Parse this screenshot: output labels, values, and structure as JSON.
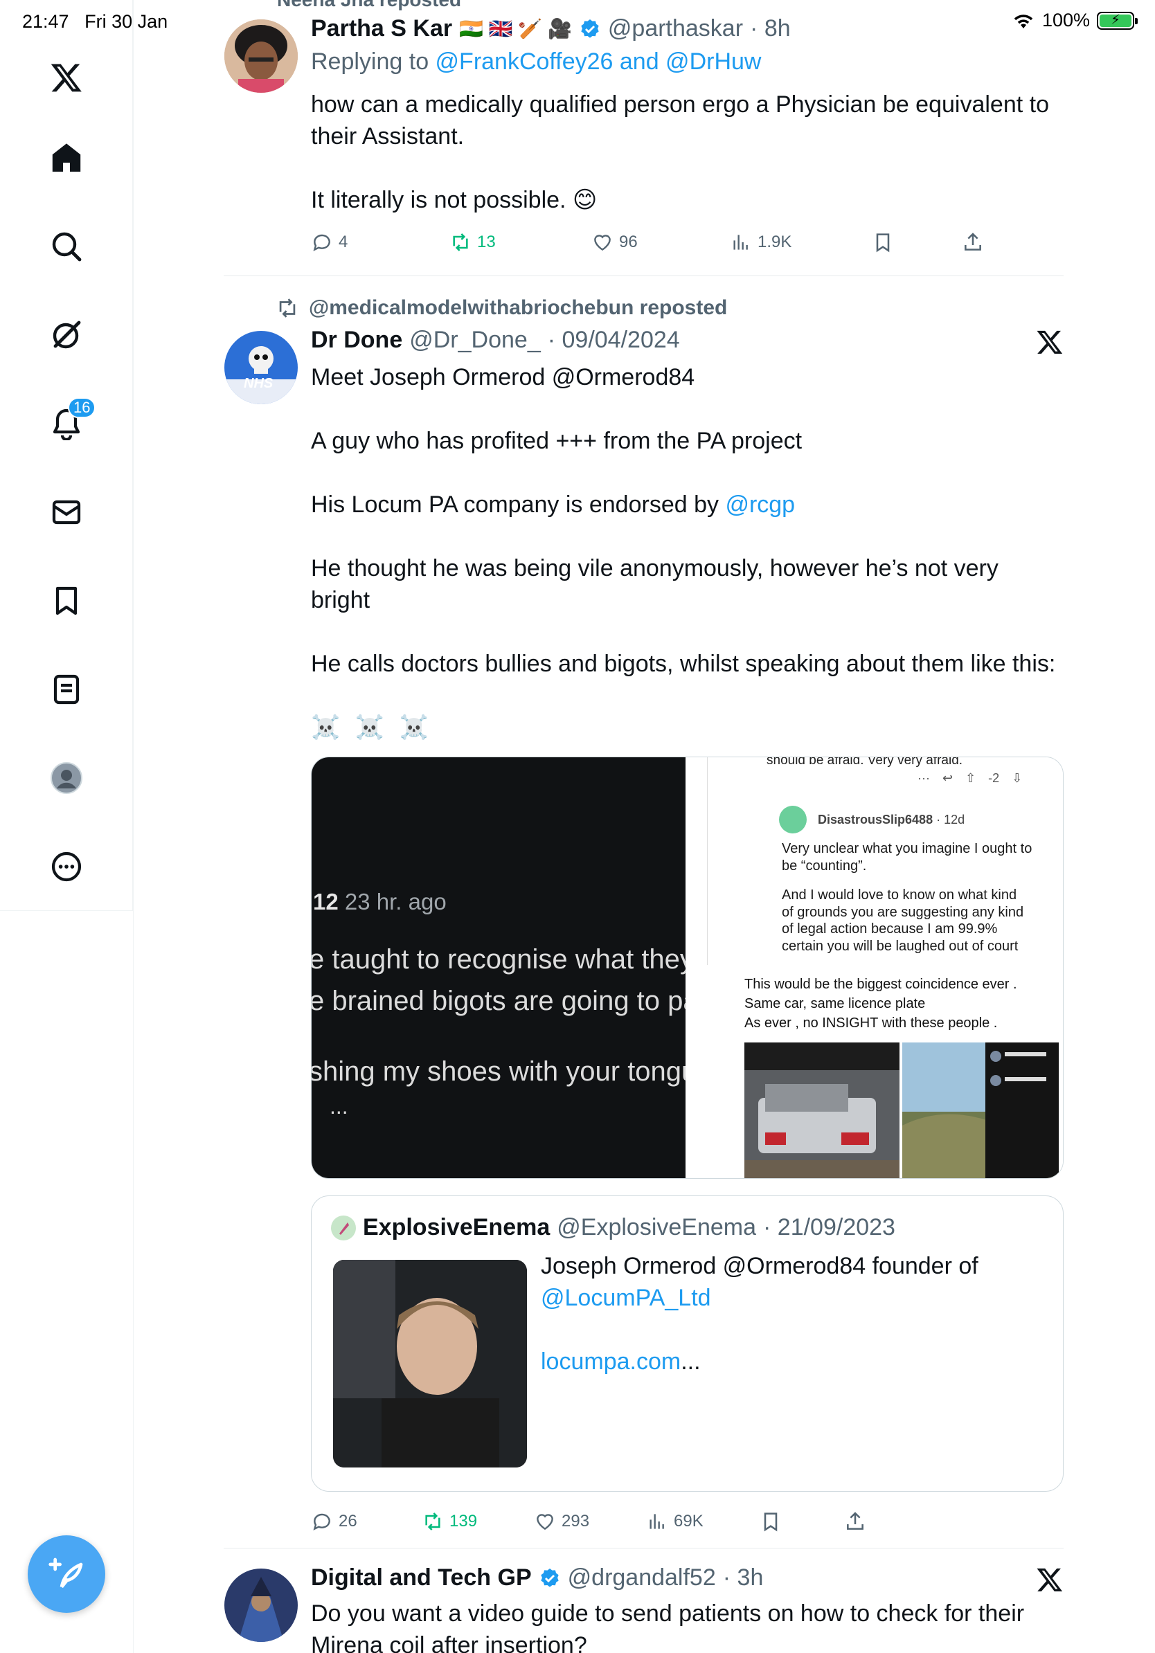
{
  "status_bar": {
    "time": "21:47",
    "date": "Fri 30 Jan",
    "battery": "100%",
    "battery_level": 1.0
  },
  "sidebar": {
    "items": [
      {
        "name": "x-logo"
      },
      {
        "name": "home"
      },
      {
        "name": "search"
      },
      {
        "name": "grok"
      },
      {
        "name": "notifications",
        "badge": "16"
      },
      {
        "name": "messages"
      },
      {
        "name": "bookmarks"
      },
      {
        "name": "lists"
      },
      {
        "name": "profile"
      },
      {
        "name": "more"
      }
    ],
    "compose_icon": "feather-plus-icon"
  },
  "tweets": [
    {
      "repost_header": "Neena Jha reposted",
      "name": "Partha S Kar",
      "name_emoji": "🇮🇳 🇬🇧 🏏 🎥",
      "handle": "@parthaskar",
      "time": "· 8h",
      "verified": true,
      "replying_prefix": "Replying to ",
      "replying_users": "@FrankCoffey26 and @DrHuw",
      "text_1": "how can a medically qualified person ergo a Physician be equivalent to",
      "text_2": "their Assistant.",
      "text_3": "It literally is not possible. 😊",
      "replies": "4",
      "reposts": "13",
      "likes": "96",
      "views": "1.9K"
    },
    {
      "repost_header": "@medicalmodelwithabriochebun reposted",
      "name": "Dr Done",
      "handle": "@Dr_Done_",
      "time": "· 09/04/2024",
      "lines": [
        "Meet Joseph Ormerod @Ormerod84",
        "A guy who has profited +++ from the PA project",
        "His Locum PA company is endorsed by ",
        "He thought he was being vile anonymously, however he’s not very",
        "bright",
        "He calls doctors bullies and bigots, whilst speaking about them like this:",
        "☠️ ☠️ ☠️"
      ],
      "mention_rcgp": "@rcgp",
      "media_left": {
        "meta_user": "12",
        "meta_time": "23 hr. ago",
        "line_1": "e taught to recognise what they",
        "line_2": "e brained bigots are going to pa",
        "line_3": "shing my shoes with your tongu",
        "ellipsis": "..."
      },
      "media_right": {
        "top_text": "should be afraid. Very very afraid.",
        "vote_count": "-2",
        "comment_user": "DisastrousSlip6488",
        "comment_age": "· 12d",
        "comment_1": "Very unclear what you imagine I ought to",
        "comment_2": "be “counting”.",
        "comment_3": "And I would love to know on what kind",
        "comment_4": "of grounds you are suggesting any kind",
        "comment_5": "of legal action because I am 99.9%",
        "comment_6": "certain you will be laughed out of court",
        "caption_1": "This would be the biggest coincidence ever .",
        "caption_2": "Same car,  same licence plate",
        "caption_3": "As ever , no INSIGHT with these people ."
      },
      "quote": {
        "name": "ExplosiveEnema",
        "handle": "@ExplosiveEnema",
        "time": "· 21/09/2023",
        "text_1": "Joseph Ormerod @Ormerod84 founder of",
        "link_1": "@LocumPA_Ltd",
        "link_2": "locumpa.com",
        "link_2_suffix": "..."
      },
      "replies": "26",
      "reposts": "139",
      "likes": "293",
      "views": "69K"
    },
    {
      "name": "Digital and Tech GP",
      "handle": "@drgandalf52",
      "time": "· 3h",
      "verified": true,
      "text_1": "Do you want a video guide to send patients on how to check for their",
      "text_2": "Mirena coil after insertion?"
    }
  ],
  "colors": {
    "accent": "#1d9bf0",
    "repost_green": "#00ba7c",
    "muted": "#536471",
    "text": "#0f1419"
  }
}
